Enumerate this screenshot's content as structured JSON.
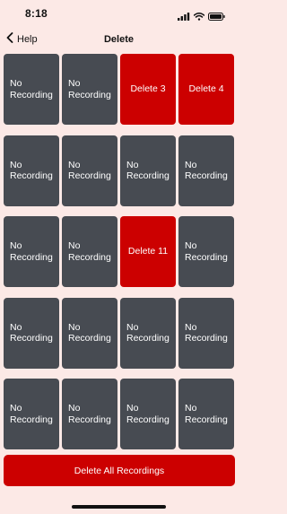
{
  "status_bar": {
    "time": "8:18",
    "icons": [
      "cellular-signal-icon",
      "wifi-icon",
      "battery-icon"
    ]
  },
  "nav": {
    "back_label": "Help",
    "title": "Delete"
  },
  "tiles": [
    {
      "label": "No\nRecording",
      "recorded": false
    },
    {
      "label": "No\nRecording",
      "recorded": false
    },
    {
      "label": "Delete 3",
      "recorded": true
    },
    {
      "label": "Delete 4",
      "recorded": true
    },
    {
      "label": "No\nRecording",
      "recorded": false
    },
    {
      "label": "No\nRecording",
      "recorded": false
    },
    {
      "label": "No\nRecording",
      "recorded": false
    },
    {
      "label": "No\nRecording",
      "recorded": false
    },
    {
      "label": "No\nRecording",
      "recorded": false
    },
    {
      "label": "No\nRecording",
      "recorded": false
    },
    {
      "label": "Delete 11",
      "recorded": true
    },
    {
      "label": "No\nRecording",
      "recorded": false
    },
    {
      "label": "No\nRecording",
      "recorded": false
    },
    {
      "label": "No\nRecording",
      "recorded": false
    },
    {
      "label": "No\nRecording",
      "recorded": false
    },
    {
      "label": "No\nRecording",
      "recorded": false
    },
    {
      "label": "No\nRecording",
      "recorded": false
    },
    {
      "label": "No\nRecording",
      "recorded": false
    },
    {
      "label": "No\nRecording",
      "recorded": false
    },
    {
      "label": "No\nRecording",
      "recorded": false
    }
  ],
  "delete_all_label": "Delete All Recordings",
  "colors": {
    "background": "#fce9e6",
    "tile_empty": "#474b52",
    "tile_recorded": "#cc0000",
    "delete_all": "#cc0000"
  }
}
